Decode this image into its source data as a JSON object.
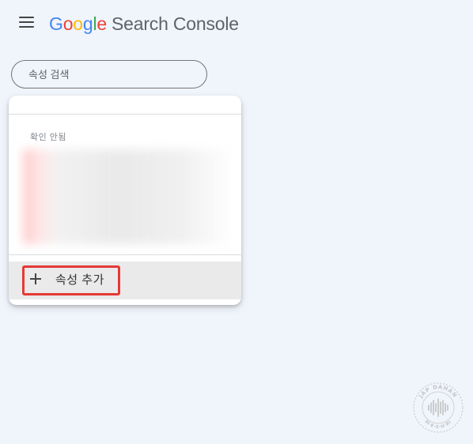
{
  "header": {
    "menu_icon": "hamburger-menu-icon",
    "logo": {
      "letters": [
        "G",
        "o",
        "o",
        "g",
        "l",
        "e"
      ],
      "product": "Search Console"
    }
  },
  "search": {
    "placeholder": "속성 검색"
  },
  "dropdown": {
    "section_label": "확인 안됨",
    "add_property": {
      "icon": "plus-icon",
      "label": "속성 추가",
      "highlight_color": "#e53935"
    }
  },
  "watermark": {
    "text_top": "JAP DAHAN",
    "text_bottom": "M·E·S·H·RI"
  },
  "colors": {
    "background": "#f0f4fb",
    "google_blue": "#4285f4",
    "google_red": "#ea4335",
    "google_yellow": "#fbbc05",
    "google_green": "#34a853"
  }
}
